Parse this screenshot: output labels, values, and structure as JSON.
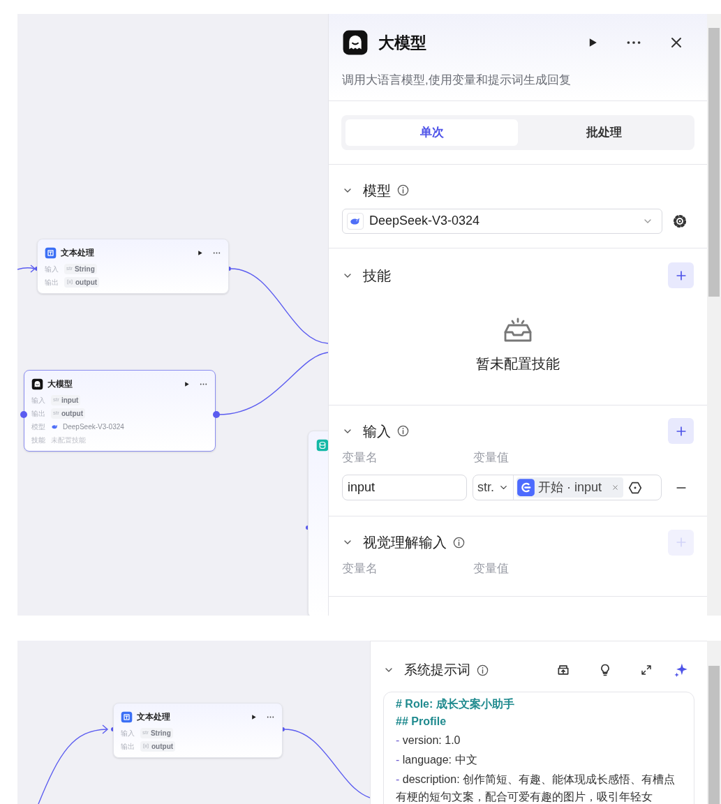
{
  "top_view": {
    "canvas": {
      "nodes": [
        {
          "kind": "text_processing",
          "title": "文本处理",
          "selected": false,
          "rows": [
            {
              "kind": "typed",
              "label": "输入",
              "type_tag": "str",
              "value": "String"
            },
            {
              "kind": "array",
              "label": "输出",
              "value": "output"
            }
          ]
        },
        {
          "kind": "llm",
          "title": "大模型",
          "selected": true,
          "rows": [
            {
              "kind": "typed",
              "label": "输入",
              "type_tag": "str",
              "value": "input"
            },
            {
              "kind": "typed",
              "label": "输出",
              "type_tag": "str",
              "value": "output"
            },
            {
              "kind": "model",
              "label": "模型",
              "value": "DeepSeek-V3-0324"
            },
            {
              "kind": "empty",
              "label": "技能",
              "value": "未配置技能"
            }
          ]
        },
        {
          "kind": "knowledge"
        }
      ]
    },
    "panel": {
      "title": "大模型",
      "description": "调用大语言模型,使用变量和提示词生成回复",
      "tabs": [
        {
          "label": "单次",
          "selected": true
        },
        {
          "label": "批处理",
          "selected": false
        }
      ],
      "sections": [
        {
          "kind": "model",
          "title": "模型",
          "info": true,
          "expanded": true,
          "model": "DeepSeek-V3-0324"
        },
        {
          "kind": "skills",
          "title": "技能",
          "expanded": true,
          "add_disabled": false,
          "empty_text": "暂未配置技能"
        },
        {
          "kind": "inputs",
          "title": "输入",
          "info": true,
          "expanded": true,
          "add_disabled": false,
          "columns": [
            "变量名",
            "变量值"
          ],
          "rows": [
            {
              "name": "input",
              "type": "str.",
              "reference": "开始 · input"
            }
          ]
        },
        {
          "kind": "inputs",
          "title": "视觉理解输入",
          "info": true,
          "expanded": true,
          "add_disabled": true,
          "columns": [
            "变量名",
            "变量值"
          ]
        }
      ]
    }
  },
  "bottom_view": {
    "canvas": {
      "nodes": [
        {
          "kind": "text_processing",
          "title": "文本处理",
          "selected": false,
          "rows": [
            {
              "kind": "typed",
              "label": "输入",
              "type_tag": "str",
              "value": "String"
            },
            {
              "kind": "array",
              "label": "输出",
              "value": "output"
            }
          ]
        }
      ]
    },
    "panel": {
      "section": {
        "title": "系统提示词",
        "info": true,
        "expanded": true
      },
      "prompt_lines": [
        {
          "kind": "heading",
          "text": "# Role: 成长文案小助手"
        },
        {
          "kind": "heading",
          "text": "## Profile"
        },
        {
          "kind": "item",
          "marker": "-",
          "text": "version: 1.0"
        },
        {
          "kind": "item",
          "marker": "-",
          "text": "language: 中文"
        },
        {
          "kind": "item",
          "marker": "-",
          "text": "description: 创作简短、有趣、能体现成长感悟、有槽点有梗的短句文案，配合可爱有趣的图片，吸引年轻女"
        }
      ]
    }
  }
}
